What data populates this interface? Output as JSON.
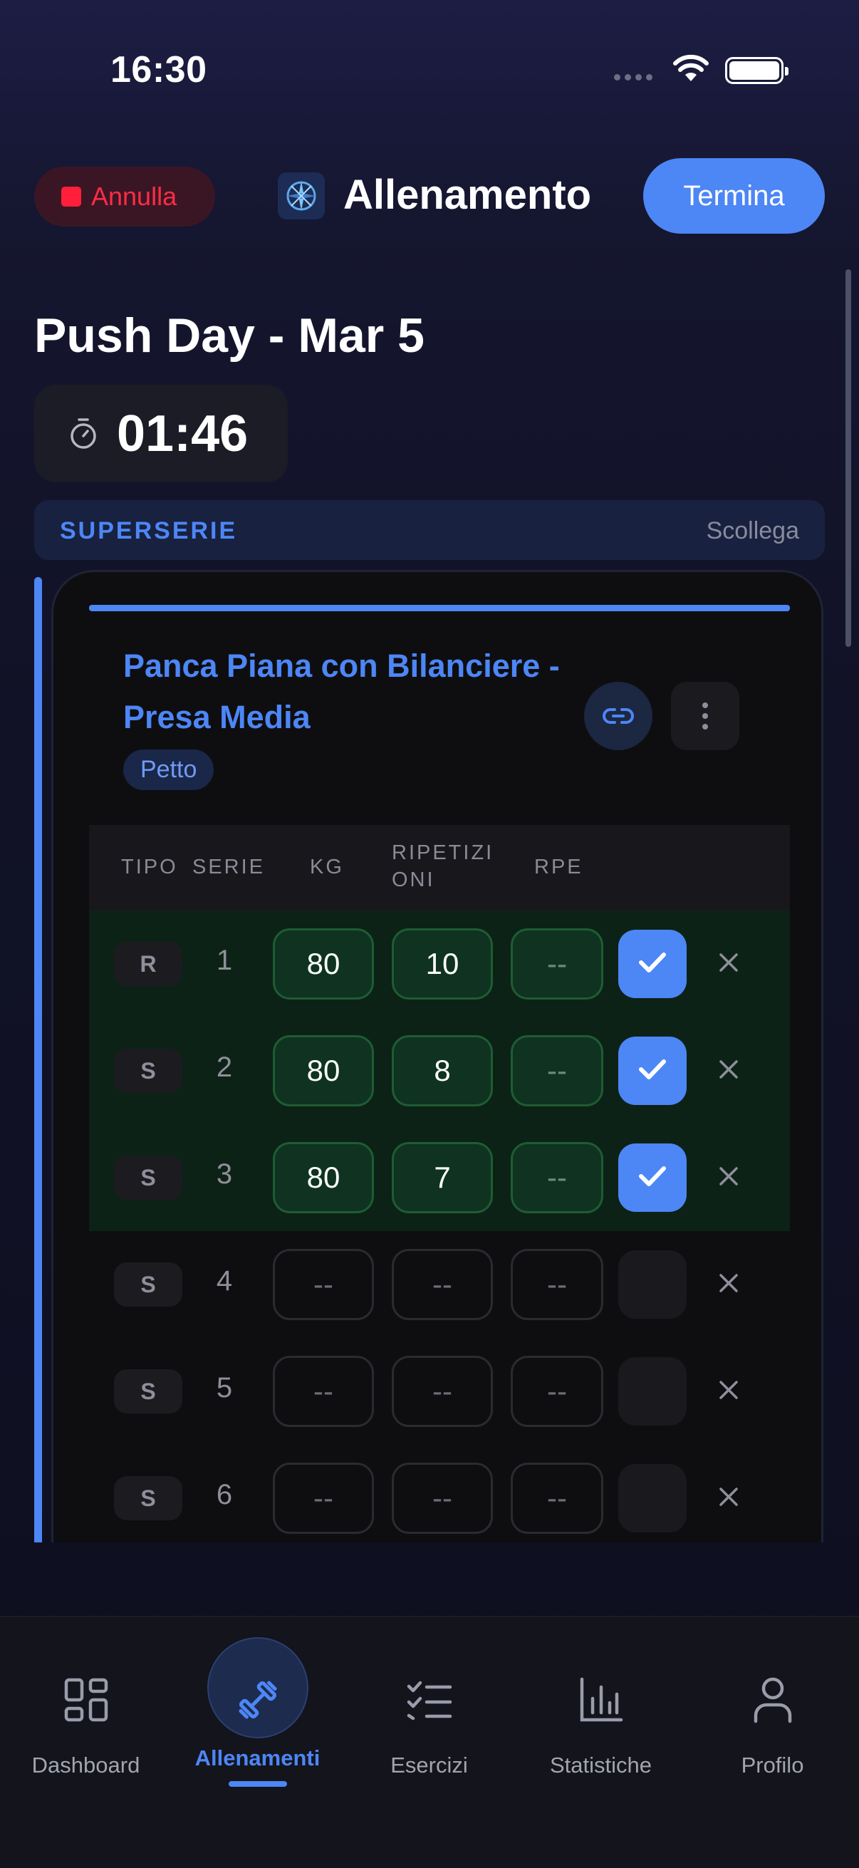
{
  "status_bar": {
    "time": "16:30"
  },
  "header": {
    "cancel_label": "Annulla",
    "title": "Allenamento",
    "finish_label": "Termina"
  },
  "workout": {
    "title": "Push Day - Mar 5",
    "timer": "01:46"
  },
  "superset": {
    "label": "SUPERSERIE",
    "unlink_label": "Scollega"
  },
  "exercise": {
    "name": "Panca Piana con Bilanciere - Presa Media",
    "muscle": "Petto",
    "columns": {
      "type": "TIPO",
      "set": "SERIE",
      "kg": "KG",
      "reps": "RIPETIZI\nONI",
      "rpe": "RPE"
    },
    "sets": [
      {
        "type": "R",
        "num": "1",
        "kg": "80",
        "reps": "10",
        "rpe": "--",
        "done": true
      },
      {
        "type": "S",
        "num": "2",
        "kg": "80",
        "reps": "8",
        "rpe": "--",
        "done": true
      },
      {
        "type": "S",
        "num": "3",
        "kg": "80",
        "reps": "7",
        "rpe": "--",
        "done": true
      },
      {
        "type": "S",
        "num": "4",
        "kg": "--",
        "reps": "--",
        "rpe": "--",
        "done": false
      },
      {
        "type": "S",
        "num": "5",
        "kg": "--",
        "reps": "--",
        "rpe": "--",
        "done": false
      },
      {
        "type": "S",
        "num": "6",
        "kg": "--",
        "reps": "--",
        "rpe": "--",
        "done": false
      }
    ]
  },
  "tabbar": {
    "active": "Allenamenti",
    "items": [
      {
        "label": "Dashboard",
        "icon": "dashboard-grid-icon"
      },
      {
        "label": "Allenamenti",
        "icon": "dumbbell-icon"
      },
      {
        "label": "Esercizi",
        "icon": "checklist-icon"
      },
      {
        "label": "Statistiche",
        "icon": "bar-chart-icon"
      },
      {
        "label": "Profilo",
        "icon": "user-icon"
      }
    ]
  },
  "colors": {
    "accent": "#4d86f5",
    "danger": "#ff2c45",
    "done_row": "#0c2216"
  }
}
